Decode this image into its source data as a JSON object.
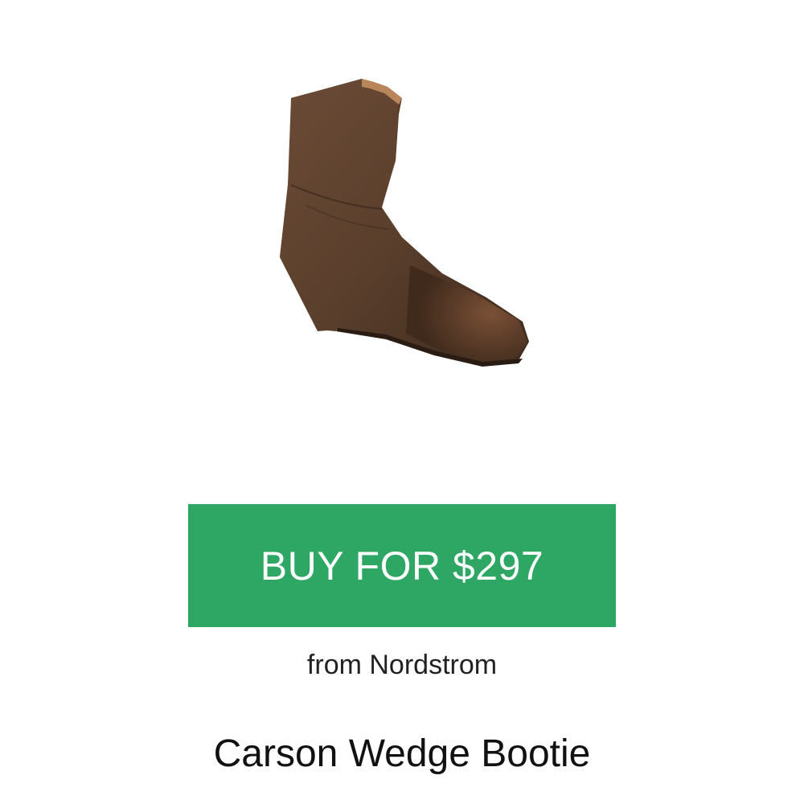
{
  "product": {
    "image_alt": "brown leather wedge ankle boot",
    "buy_label": "BUY FOR $297",
    "retailer_text": "from Nordstrom",
    "title": "Carson Wedge Bootie"
  },
  "colors": {
    "buy_button": "#2ea664",
    "boot_leather": "#5a3f2c",
    "boot_dark": "#3a281c",
    "boot_lining": "#b8865a"
  }
}
